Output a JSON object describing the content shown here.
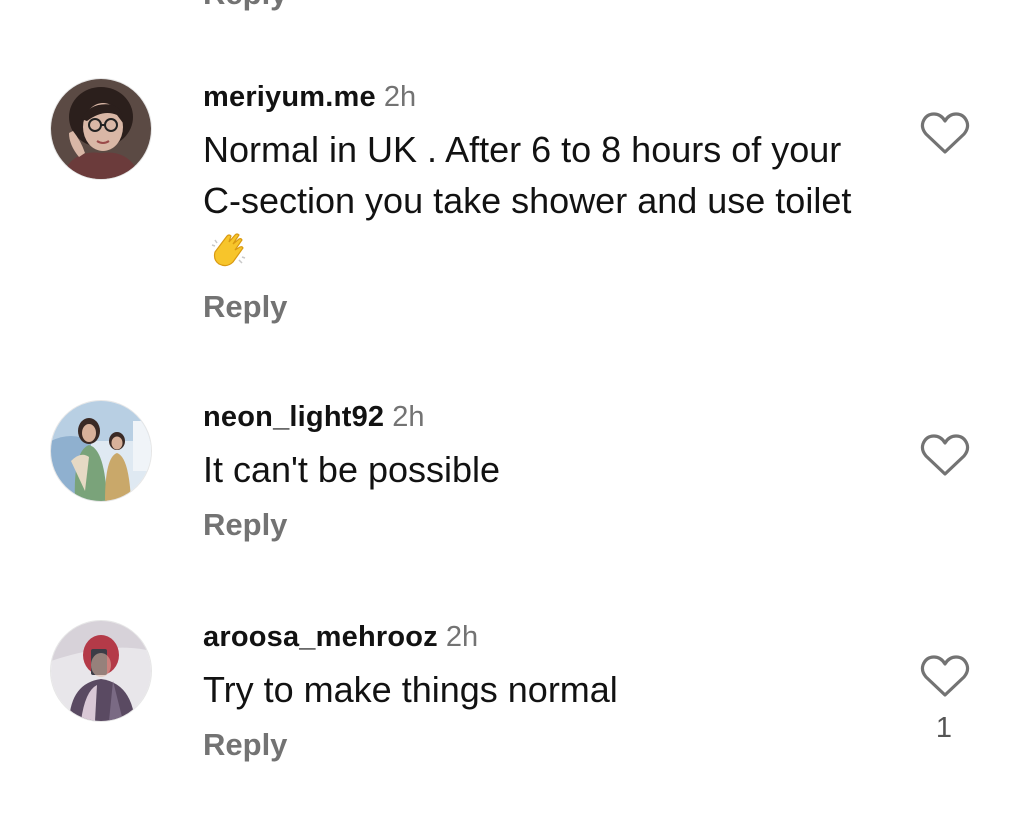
{
  "previous_comment": {
    "reply_label": "Reply"
  },
  "comments": [
    {
      "username": "meriyum.me",
      "time": "2h",
      "text": "Normal in UK . After 6 to 8 hours of your C-section you take shower and use toilet",
      "emoji": "clapping-hands",
      "reply_label": "Reply",
      "like_count": ""
    },
    {
      "username": "neon_light92",
      "time": "2h",
      "text": "It can't be possible",
      "reply_label": "Reply",
      "like_count": ""
    },
    {
      "username": "aroosa_mehrooz",
      "time": "2h",
      "text": "Try to make things normal",
      "reply_label": "Reply",
      "like_count": "1"
    }
  ],
  "colors": {
    "text_primary": "#121212",
    "text_secondary": "#737373",
    "background": "#ffffff",
    "emoji_yellow": "#f7c52b"
  },
  "icons": {
    "like": "heart-outline-icon"
  }
}
